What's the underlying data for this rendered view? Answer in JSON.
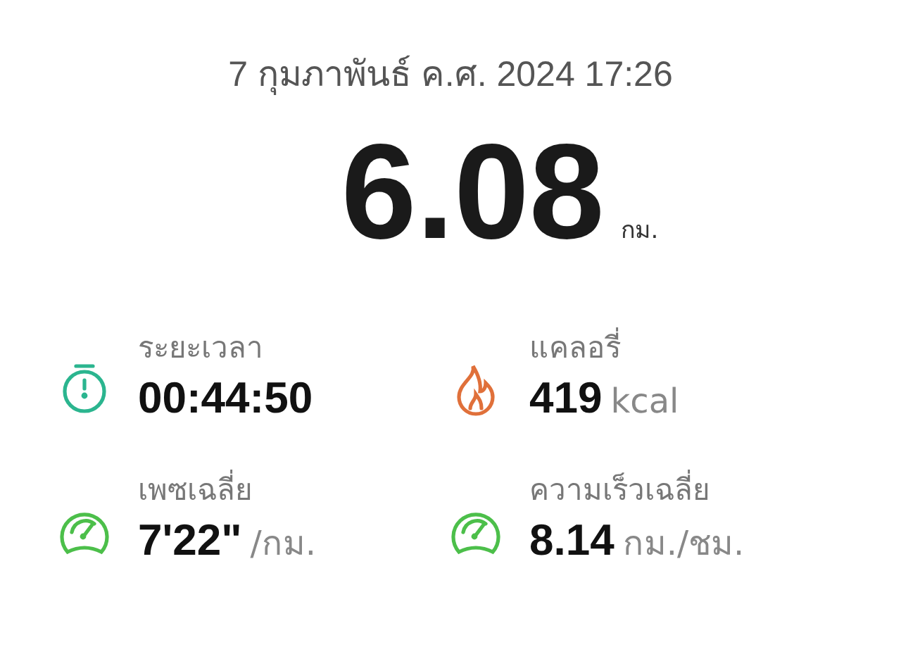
{
  "date": "7 กุมภาพันธ์ ค.ศ. 2024 17:26",
  "distance": {
    "value": "6.08",
    "unit": "กม."
  },
  "stats": [
    {
      "kind": "duration",
      "label": "ระยะเวลา",
      "value": "00:44:50",
      "color": "#2bb58f"
    },
    {
      "kind": "calories",
      "label": "แคลอรี่",
      "value": "419",
      "unit": "kcal",
      "color": "#e0703a"
    },
    {
      "kind": "pace",
      "label": "เพซเฉลี่ย",
      "value": "7'22\"",
      "unit": "/กม.",
      "color": "#4cbf4a"
    },
    {
      "kind": "speed",
      "label": "ความเร็วเฉลี่ย",
      "value": "8.14",
      "unit": "กม./ชม.",
      "color": "#4cbf4a"
    }
  ]
}
